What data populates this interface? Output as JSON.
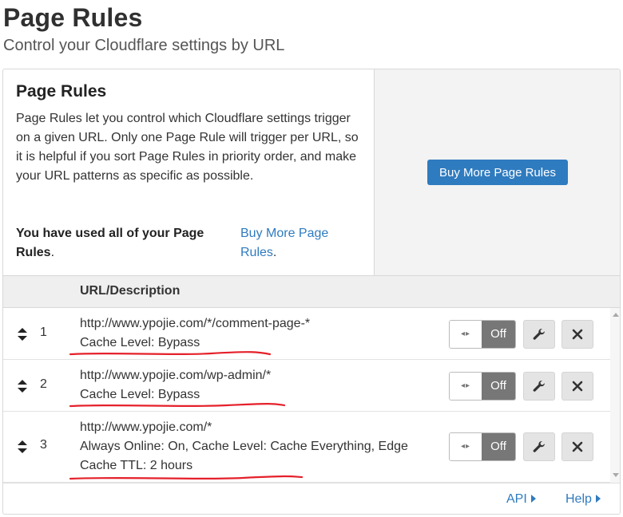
{
  "header": {
    "title": "Page Rules",
    "subtitle": "Control your Cloudflare settings by URL"
  },
  "info": {
    "title": "Page Rules",
    "description": "Page Rules let you control which Cloudflare settings trigger on a given URL. Only one Page Rule will trigger per URL, so it is helpful if you sort Page Rules in priority order, and make your URL patterns as specific as possible.",
    "used_bold": "You have used all of your Page Rules",
    "used_suffix": ".",
    "buy_link": "Buy More Page Rules",
    "buy_link_suffix": "."
  },
  "cta": {
    "button_label": "Buy More Page Rules",
    "button_color": "#2f7bbf"
  },
  "table": {
    "column_header": "URL/Description",
    "rows": [
      {
        "number": "1",
        "url": "http://www.ypojie.com/*/comment-page-*",
        "settings": "Cache Level: Bypass",
        "toggle_state": "Off"
      },
      {
        "number": "2",
        "url": "http://www.ypojie.com/wp-admin/*",
        "settings": "Cache Level: Bypass",
        "toggle_state": "Off"
      },
      {
        "number": "3",
        "url": "http://www.ypojie.com/*",
        "settings": "Always Online: On, Cache Level: Cache Everything, Edge Cache TTL: 2 hours",
        "toggle_state": "Off"
      }
    ],
    "icons": {
      "drag": "sort-arrows-icon",
      "toggle_knob": "arrows-icon",
      "edit": "wrench-icon",
      "delete": "close-icon"
    }
  },
  "footer": {
    "api_label": "API",
    "help_label": "Help",
    "link_color": "#2f7bbf"
  },
  "annotation_color": "#e5202a"
}
